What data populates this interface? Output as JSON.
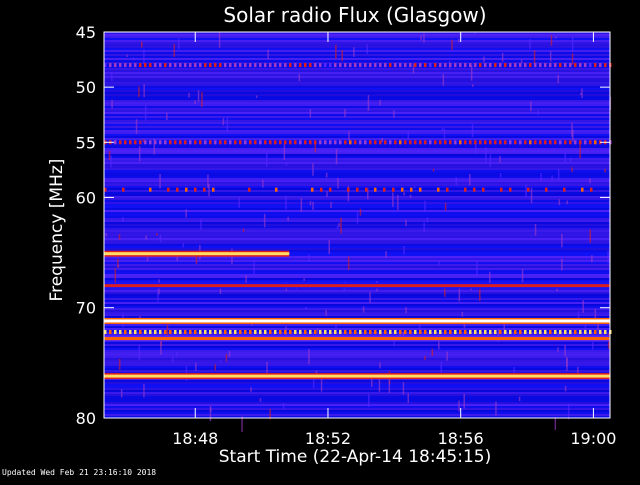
{
  "chart_data": {
    "type": "heatmap",
    "title": "Solar radio Flux (Glasgow)",
    "xlabel": "Start Time (22-Apr-14 18:45:15)",
    "ylabel": "Frequency [MHz]",
    "x_range_minutes": [
      "18:45:15",
      "19:00:30"
    ],
    "y_range_mhz": [
      45,
      80
    ],
    "y_axis_inverted": true,
    "x_ticks": [
      "18:48",
      "18:52",
      "18:56",
      "19:00"
    ],
    "y_ticks": [
      45,
      50,
      55,
      60,
      70,
      80
    ],
    "colormap": [
      "#0000c8",
      "#1414ff",
      "#5a28ff",
      "#a03cc8",
      "#dc1e1e",
      "#ff6400",
      "#ffdc64",
      "#ffffff"
    ],
    "emission_bands": [
      {
        "freq_mhz": 48.0,
        "intensity": 0.45,
        "t_start": "18:45:15",
        "t_end": "19:00:30",
        "pattern": "dashed"
      },
      {
        "freq_mhz": 55.0,
        "intensity": 0.55,
        "t_start": "18:45:15",
        "t_end": "19:00:30",
        "pattern": "dashed"
      },
      {
        "freq_mhz": 59.3,
        "intensity": 0.6,
        "t_start": "18:45:15",
        "t_end": "19:00:30",
        "pattern": "sparse"
      },
      {
        "freq_mhz": 65.1,
        "intensity": 0.85,
        "t_start": "18:45:15",
        "t_end": "18:50:50",
        "pattern": "solid"
      },
      {
        "freq_mhz": 68.0,
        "intensity": 0.5,
        "t_start": "18:45:15",
        "t_end": "19:00:30",
        "pattern": "solid"
      },
      {
        "freq_mhz": 71.2,
        "intensity": 1.0,
        "t_start": "18:45:15",
        "t_end": "19:00:30",
        "pattern": "solid"
      },
      {
        "freq_mhz": 72.2,
        "intensity": 0.8,
        "t_start": "18:45:15",
        "t_end": "19:00:30",
        "pattern": "dashed"
      },
      {
        "freq_mhz": 72.8,
        "intensity": 0.65,
        "t_start": "18:45:15",
        "t_end": "19:00:30",
        "pattern": "solid"
      },
      {
        "freq_mhz": 76.2,
        "intensity": 0.8,
        "t_start": "18:45:15",
        "t_end": "19:00:30",
        "pattern": "solid"
      }
    ],
    "grid": false
  },
  "footer": "Updated Wed Feb 21 23:16:10 2018"
}
